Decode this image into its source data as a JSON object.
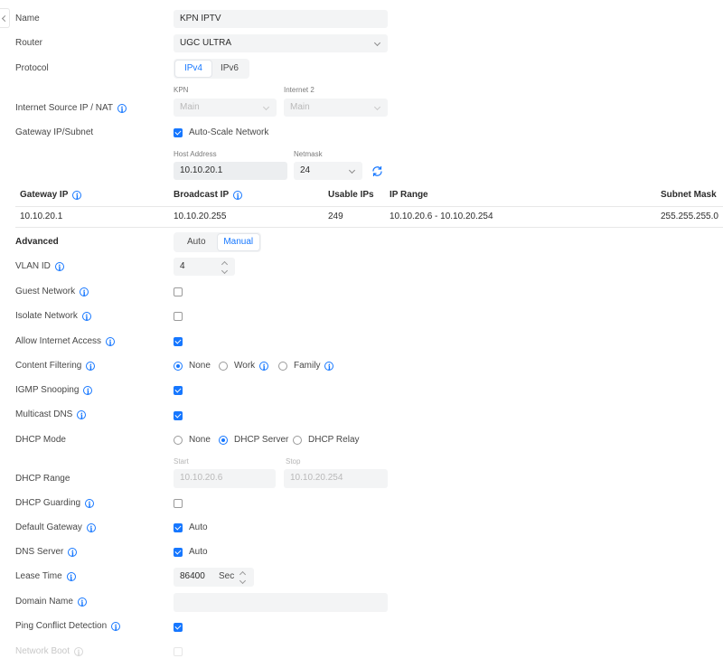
{
  "back_icon": "chevron-left-icon",
  "info_icon": "info-circle-icon",
  "refresh_icon": "refresh-icon",
  "accent_color": "#1677ff",
  "form": {
    "name": {
      "label": "Name",
      "value": "KPN IPTV"
    },
    "router": {
      "label": "Router",
      "value": "UGC ULTRA"
    },
    "protocol": {
      "label": "Protocol",
      "options": [
        "IPv4",
        "IPv6"
      ],
      "selected": "IPv4"
    },
    "internet_source": {
      "label": "Internet Source IP / NAT",
      "kpn": {
        "caption": "KPN",
        "value": "Main"
      },
      "internet2": {
        "caption": "Internet 2",
        "value": "Main"
      }
    },
    "gateway": {
      "label": "Gateway IP/Subnet",
      "auto_scale_label": "Auto-Scale Network",
      "auto_scale_checked": true,
      "host_address_caption": "Host Address",
      "host_address_value": "10.10.20.1",
      "netmask_caption": "Netmask",
      "netmask_value": "24"
    }
  },
  "table": {
    "headers": [
      "Gateway IP",
      "Broadcast IP",
      "Usable IPs",
      "IP Range",
      "Subnet Mask"
    ],
    "row": [
      "10.10.20.1",
      "10.10.20.255",
      "249",
      "10.10.20.6 - 10.10.20.254",
      "255.255.255.0"
    ]
  },
  "advanced": {
    "label": "Advanced",
    "modes": [
      "Auto",
      "Manual"
    ],
    "selected": "Manual",
    "vlan_id": {
      "label": "VLAN ID",
      "value": "4"
    },
    "guest_network": {
      "label": "Guest Network",
      "checked": false
    },
    "isolate_network": {
      "label": "Isolate Network",
      "checked": false
    },
    "allow_internet_access": {
      "label": "Allow Internet Access",
      "checked": true
    },
    "content_filtering": {
      "label": "Content Filtering",
      "options": [
        "None",
        "Work",
        "Family"
      ],
      "selected": "None"
    },
    "igmp_snooping": {
      "label": "IGMP Snooping",
      "checked": true
    },
    "multicast_dns": {
      "label": "Multicast DNS",
      "checked": true
    },
    "dhcp_mode": {
      "label": "DHCP Mode",
      "options": [
        "None",
        "DHCP Server",
        "DHCP Relay"
      ],
      "selected": "DHCP Server"
    },
    "dhcp_range": {
      "label": "DHCP Range",
      "start_caption": "Start",
      "start_value": "10.10.20.6",
      "stop_caption": "Stop",
      "stop_value": "10.10.20.254"
    },
    "dhcp_guarding": {
      "label": "DHCP Guarding",
      "checked": false
    },
    "default_gateway": {
      "label": "Default Gateway",
      "checked": true,
      "checkbox_label": "Auto"
    },
    "dns_server": {
      "label": "DNS Server",
      "checked": true,
      "checkbox_label": "Auto"
    },
    "lease_time": {
      "label": "Lease Time",
      "value": "86400",
      "unit": "Sec"
    },
    "domain_name": {
      "label": "Domain Name",
      "value": ""
    },
    "ping_conflict_detection": {
      "label": "Ping Conflict Detection",
      "checked": true
    },
    "network_boot": {
      "label": "Network Boot",
      "checked": false
    }
  }
}
